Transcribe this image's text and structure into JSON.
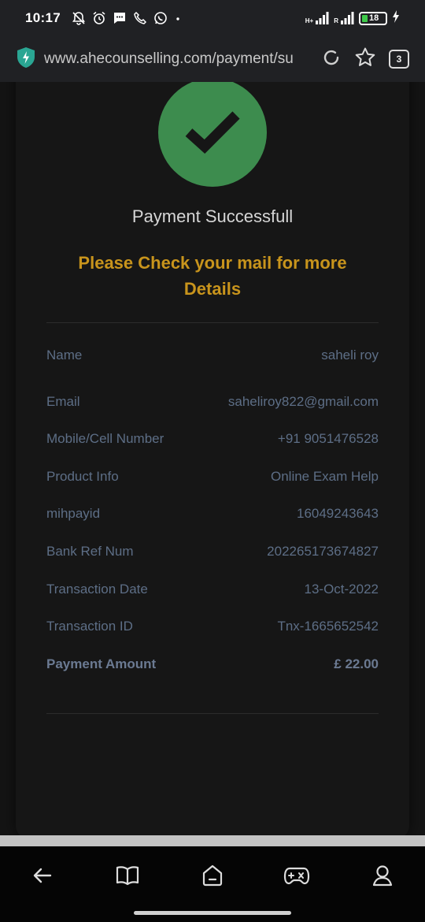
{
  "status_bar": {
    "time": "10:17",
    "signal1_label": "H+",
    "signal2_label": "R",
    "battery": "18",
    "icons": [
      "muted-bell-icon",
      "alarm-icon",
      "message-icon",
      "phone-icon",
      "whatsapp-icon",
      "dot-icon",
      "signal-icon",
      "signal-icon",
      "battery-icon",
      "charging-icon"
    ]
  },
  "browser": {
    "url": "www.ahecounselling.com/payment/su",
    "tab_count": "3",
    "icons": [
      "shield-icon",
      "reload-icon",
      "star-icon",
      "tabs-icon"
    ]
  },
  "payment": {
    "title": "Payment Successfull",
    "notice": "Please Check your mail for more Details",
    "rows": [
      {
        "label": "Name",
        "value": "saheli roy"
      },
      {
        "label": "Email",
        "value": "saheliroy822@gmail.com"
      },
      {
        "label": "Mobile/Cell Number",
        "value": "+91 9051476528"
      },
      {
        "label": "Product Info",
        "value": "Online Exam Help"
      },
      {
        "label": "mihpayid",
        "value": "16049243643"
      },
      {
        "label": "Bank Ref Num",
        "value": "202265173674827"
      },
      {
        "label": "Transaction Date",
        "value": "13-Oct-2022"
      },
      {
        "label": "Transaction ID",
        "value": "Tnx-1665652542"
      },
      {
        "label": "Payment Amount",
        "value": "£ 22.00"
      }
    ]
  },
  "colors": {
    "success_green": "#3d8c4e",
    "notice_gold": "#c8941c",
    "label_slate": "#5d6e86"
  },
  "nav": {
    "icons": [
      "back-arrow-icon",
      "book-icon",
      "home-icon",
      "gamepad-icon",
      "profile-icon"
    ]
  }
}
